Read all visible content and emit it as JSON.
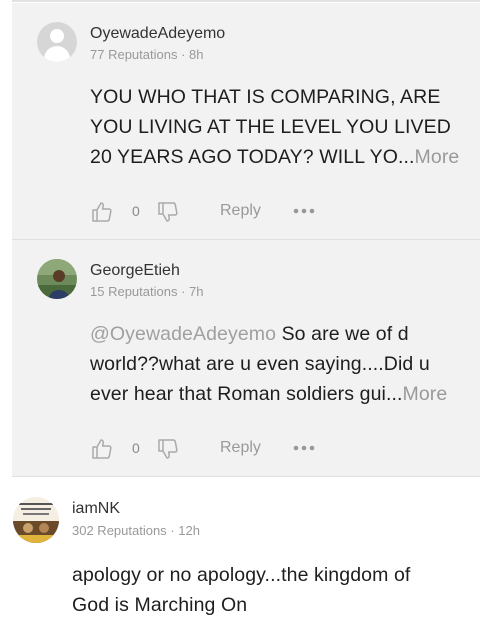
{
  "comments": [
    {
      "username": "OyewadeAdeyemo",
      "reputations": "77 Reputations",
      "separator": "·",
      "time": "8h",
      "line1": "YOU WHO THAT IS COMPARING, ARE",
      "line2": "YOU LIVING AT THE LEVEL YOU LIVED",
      "line3": "20 YEARS AGO TODAY?  WILL YO...",
      "more": "More",
      "like_count": "0",
      "reply_label": "Reply"
    },
    {
      "username": "GeorgeEtieh",
      "reputations": "15 Reputations",
      "separator": "·",
      "time": "7h",
      "mention": "@OyewadeAdeyemo",
      "line1_rest": " So are we of d",
      "line2": "world??what are u even saying....Did u",
      "line3": "ever hear that Roman soldiers gui...",
      "more": "More",
      "like_count": "0",
      "reply_label": "Reply"
    },
    {
      "username": "iamNK",
      "reputations": "302 Reputations",
      "separator": "·",
      "time": "12h",
      "line1": "apology or no apology...the kingdom of",
      "line2": "God is Marching On"
    }
  ],
  "icons": {
    "like": "thumbs-up-icon",
    "dislike": "thumbs-down-icon",
    "more": "more-dots-icon"
  },
  "colors": {
    "reply_background": "#f2f2f2",
    "muted_text": "#999999",
    "mention": "#a0a0a0"
  }
}
